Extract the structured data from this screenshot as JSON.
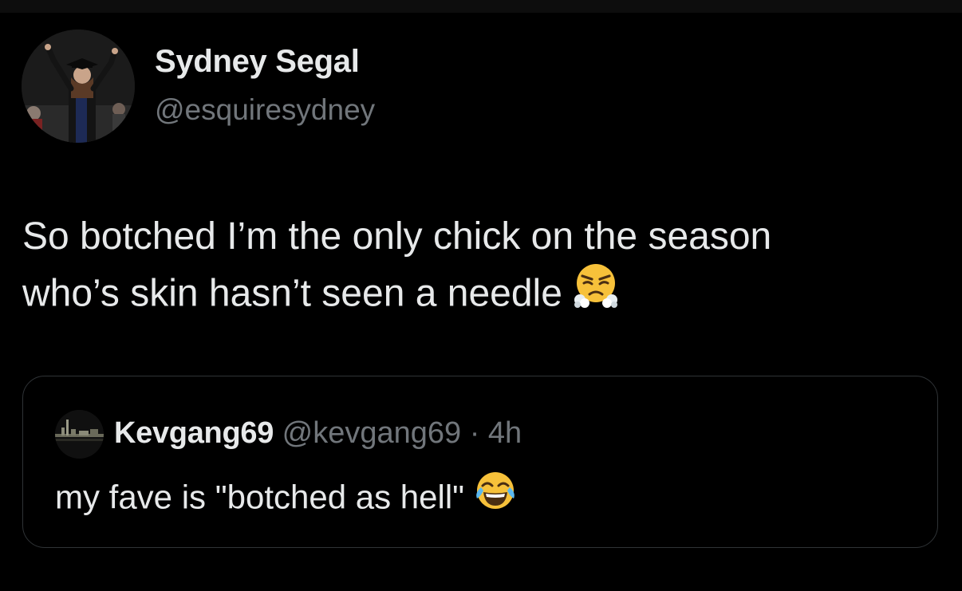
{
  "tweet": {
    "author": {
      "display_name": "Sydney Segal",
      "handle": "@esquiresydney",
      "avatar_icon": "graduation-photo-avatar"
    },
    "text_line_1": "So botched I’m the only chick on the season",
    "text_line_2": "who’s skin hasn’t seen a needle",
    "emoji_icon": "face-with-steam-from-nose-emoji"
  },
  "quoted_tweet": {
    "author": {
      "display_name": "Kevgang69",
      "handle": "@kevgang69",
      "avatar_icon": "city-skyline-avatar"
    },
    "separator": "·",
    "timestamp": "4h",
    "text": "my fave is \"botched as hell\"",
    "emoji_icon": "face-with-tears-of-joy-emoji"
  },
  "colors": {
    "background": "#000000",
    "primary_text": "#e7e9ea",
    "secondary_text": "#71767b",
    "border": "#2f3336"
  }
}
